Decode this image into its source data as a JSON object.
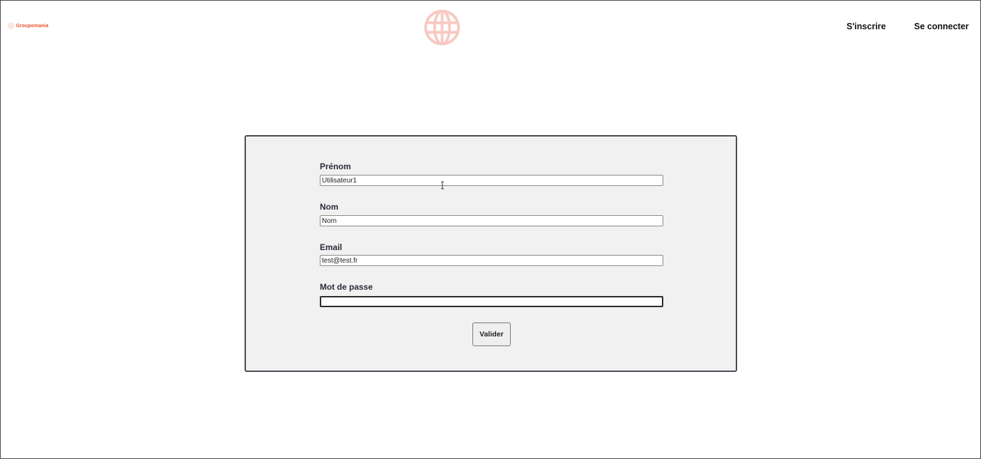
{
  "header": {
    "brand_name": "Groupomania",
    "logo_icon": "globe-icon",
    "nav": {
      "signup": "S'inscrire",
      "login": "Se connecter"
    }
  },
  "form": {
    "fields": [
      {
        "label": "Prénom",
        "value": "Utilisateur1",
        "type": "text"
      },
      {
        "label": "Nom",
        "value": "Nom",
        "type": "text"
      },
      {
        "label": "Email",
        "value": "test@test.fr",
        "type": "email"
      },
      {
        "label": "Mot de passe",
        "value": "",
        "type": "password"
      }
    ],
    "submit_label": "Valider"
  },
  "colors": {
    "brand": "#e8502e",
    "globe": "#f7c9c2",
    "panel_bg": "#f1f1f1",
    "panel_border": "#4a4a55"
  }
}
